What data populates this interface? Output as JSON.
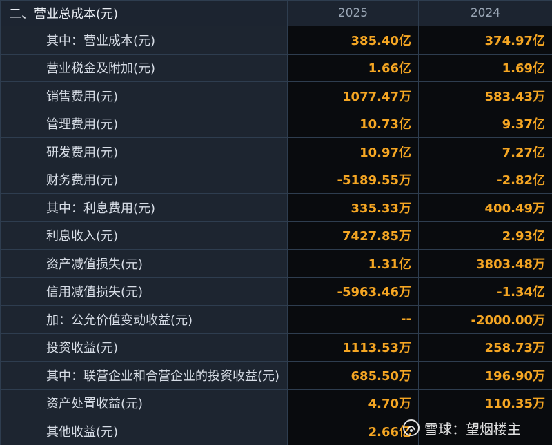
{
  "header": {
    "section_title": "二、营业总成本(元)",
    "year_1": "2025",
    "year_2": "2024"
  },
  "rows": [
    {
      "label": "其中：营业成本(元)",
      "v2025": "385.40亿",
      "v2024": "374.97亿"
    },
    {
      "label": "营业税金及附加(元)",
      "v2025": "1.66亿",
      "v2024": "1.69亿"
    },
    {
      "label": "销售费用(元)",
      "v2025": "1077.47万",
      "v2024": "583.43万"
    },
    {
      "label": "管理费用(元)",
      "v2025": "10.73亿",
      "v2024": "9.37亿"
    },
    {
      "label": "研发费用(元)",
      "v2025": "10.97亿",
      "v2024": "7.27亿"
    },
    {
      "label": "财务费用(元)",
      "v2025": "-5189.55万",
      "v2024": "-2.82亿"
    },
    {
      "label": "其中：利息费用(元)",
      "v2025": "335.33万",
      "v2024": "400.49万"
    },
    {
      "label": "利息收入(元)",
      "v2025": "7427.85万",
      "v2024": "2.93亿"
    },
    {
      "label": "资产减值损失(元)",
      "v2025": "1.31亿",
      "v2024": "3803.48万"
    },
    {
      "label": "信用减值损失(元)",
      "v2025": "-5963.46万",
      "v2024": "-1.34亿"
    },
    {
      "label": "加：公允价值变动收益(元)",
      "v2025": "--",
      "v2024": "-2000.00万"
    },
    {
      "label": "投资收益(元)",
      "v2025": "1113.53万",
      "v2024": "258.73万"
    },
    {
      "label": "其中：联营企业和合营企业的投资收益(元)",
      "v2025": "685.50万",
      "v2024": "196.90万"
    },
    {
      "label": "资产处置收益(元)",
      "v2025": "4.70万",
      "v2024": "110.35万"
    },
    {
      "label": "其他收益(元)",
      "v2025": "2.66亿",
      "v2024": ""
    }
  ],
  "watermark": {
    "text": "雪球：望烟楼主"
  },
  "colors": {
    "value_text": "#f5a623",
    "label_text": "#d7dde6",
    "grid_line": "#2e3d4f"
  }
}
